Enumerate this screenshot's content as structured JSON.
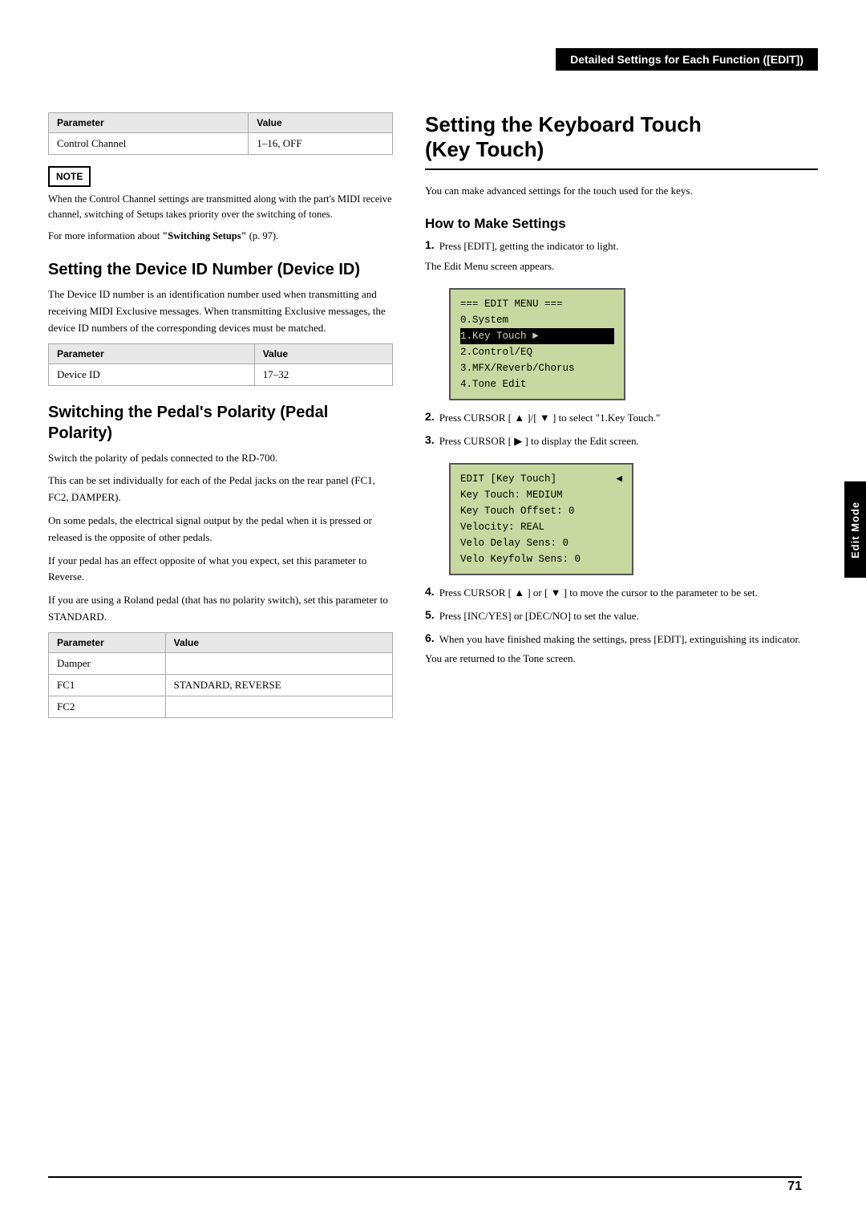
{
  "header": {
    "banner": "Detailed Settings for Each Function ([EDIT])"
  },
  "left_col": {
    "control_channel_table": {
      "headers": [
        "Parameter",
        "Value"
      ],
      "rows": [
        [
          "Control Channel",
          "1–16, OFF"
        ]
      ]
    },
    "note_label": "NOTE",
    "note_text": "When the Control Channel settings are transmitted along with the part's MIDI receive channel, switching of Setups takes priority over the switching of tones.",
    "note_link": "For more information about \"Switching Setups\" (p. 97).",
    "device_id_heading": "Setting the Device ID Number (Device ID)",
    "device_id_body": "The Device ID number is an identification number used when transmitting and receiving MIDI Exclusive messages. When transmitting Exclusive messages, the device ID numbers of the corresponding devices must be matched.",
    "device_id_table": {
      "headers": [
        "Parameter",
        "Value"
      ],
      "rows": [
        [
          "Device ID",
          "17–32"
        ]
      ]
    },
    "pedal_heading": "Switching the Pedal's Polarity (Pedal Polarity)",
    "pedal_body1": "Switch the polarity of pedals connected to the RD-700.",
    "pedal_body2": "This can be set individually for each of the Pedal jacks on the rear panel (FC1, FC2, DAMPER).",
    "pedal_body3": "On some pedals, the electrical signal output by the pedal when it is pressed or released is the opposite of other pedals.",
    "pedal_body4": "If your pedal has an effect opposite of what you expect, set this parameter to Reverse.",
    "pedal_body5": "If you are using a Roland pedal (that has no polarity switch), set this parameter to STANDARD.",
    "pedal_table": {
      "headers": [
        "Parameter",
        "Value"
      ],
      "rows": [
        [
          "Damper",
          ""
        ],
        [
          "FC1",
          "STANDARD, REVERSE"
        ],
        [
          "FC2",
          ""
        ]
      ]
    }
  },
  "right_col": {
    "main_heading_line1": "Setting the Keyboard Touch",
    "main_heading_line2": "(Key Touch)",
    "intro_text": "You can make advanced settings for the touch used for the keys.",
    "how_heading": "How to Make Settings",
    "steps": [
      {
        "num": "1.",
        "text": "Press [EDIT], getting the indicator to light."
      },
      {
        "num": "",
        "text": "The Edit Menu screen appears."
      },
      {
        "num": "2.",
        "text": "Press CURSOR [ ▲ ]/[ ▼ ] to select \"1.Key Touch.\""
      },
      {
        "num": "3.",
        "text": "Press CURSOR [ ▶ ] to display the Edit screen."
      },
      {
        "num": "4.",
        "text": "Press CURSOR [ ▲ ] or [ ▼ ] to move the cursor to the parameter to be set."
      },
      {
        "num": "5.",
        "text": "Press [INC/YES] or [DEC/NO] to set the value."
      },
      {
        "num": "6.",
        "text": "When you have finished making the settings, press [EDIT], extinguishing its indicator."
      },
      {
        "num": "",
        "text": "You are returned to the Tone screen."
      }
    ],
    "lcd1": {
      "line1": "=== EDIT MENU ===",
      "line2": "0.System",
      "line3_highlight": "1.Key Touch",
      "line4": "2.Control/EQ",
      "line5": "3.MFX/Reverb/Chorus",
      "line6": "4.Tone Edit"
    },
    "lcd2": {
      "title": "EDIT [Key Touch]",
      "arrow": "◀",
      "line1": "Key Touch:    MEDIUM",
      "line2": "Key Touch Offset:  0",
      "line3": "Velocity:       REAL",
      "line4": "Velo Delay Sens:  0",
      "line5": "Velo Keyfolw Sens: 0"
    },
    "side_tab": "Edit Mode"
  },
  "page_number": "71"
}
